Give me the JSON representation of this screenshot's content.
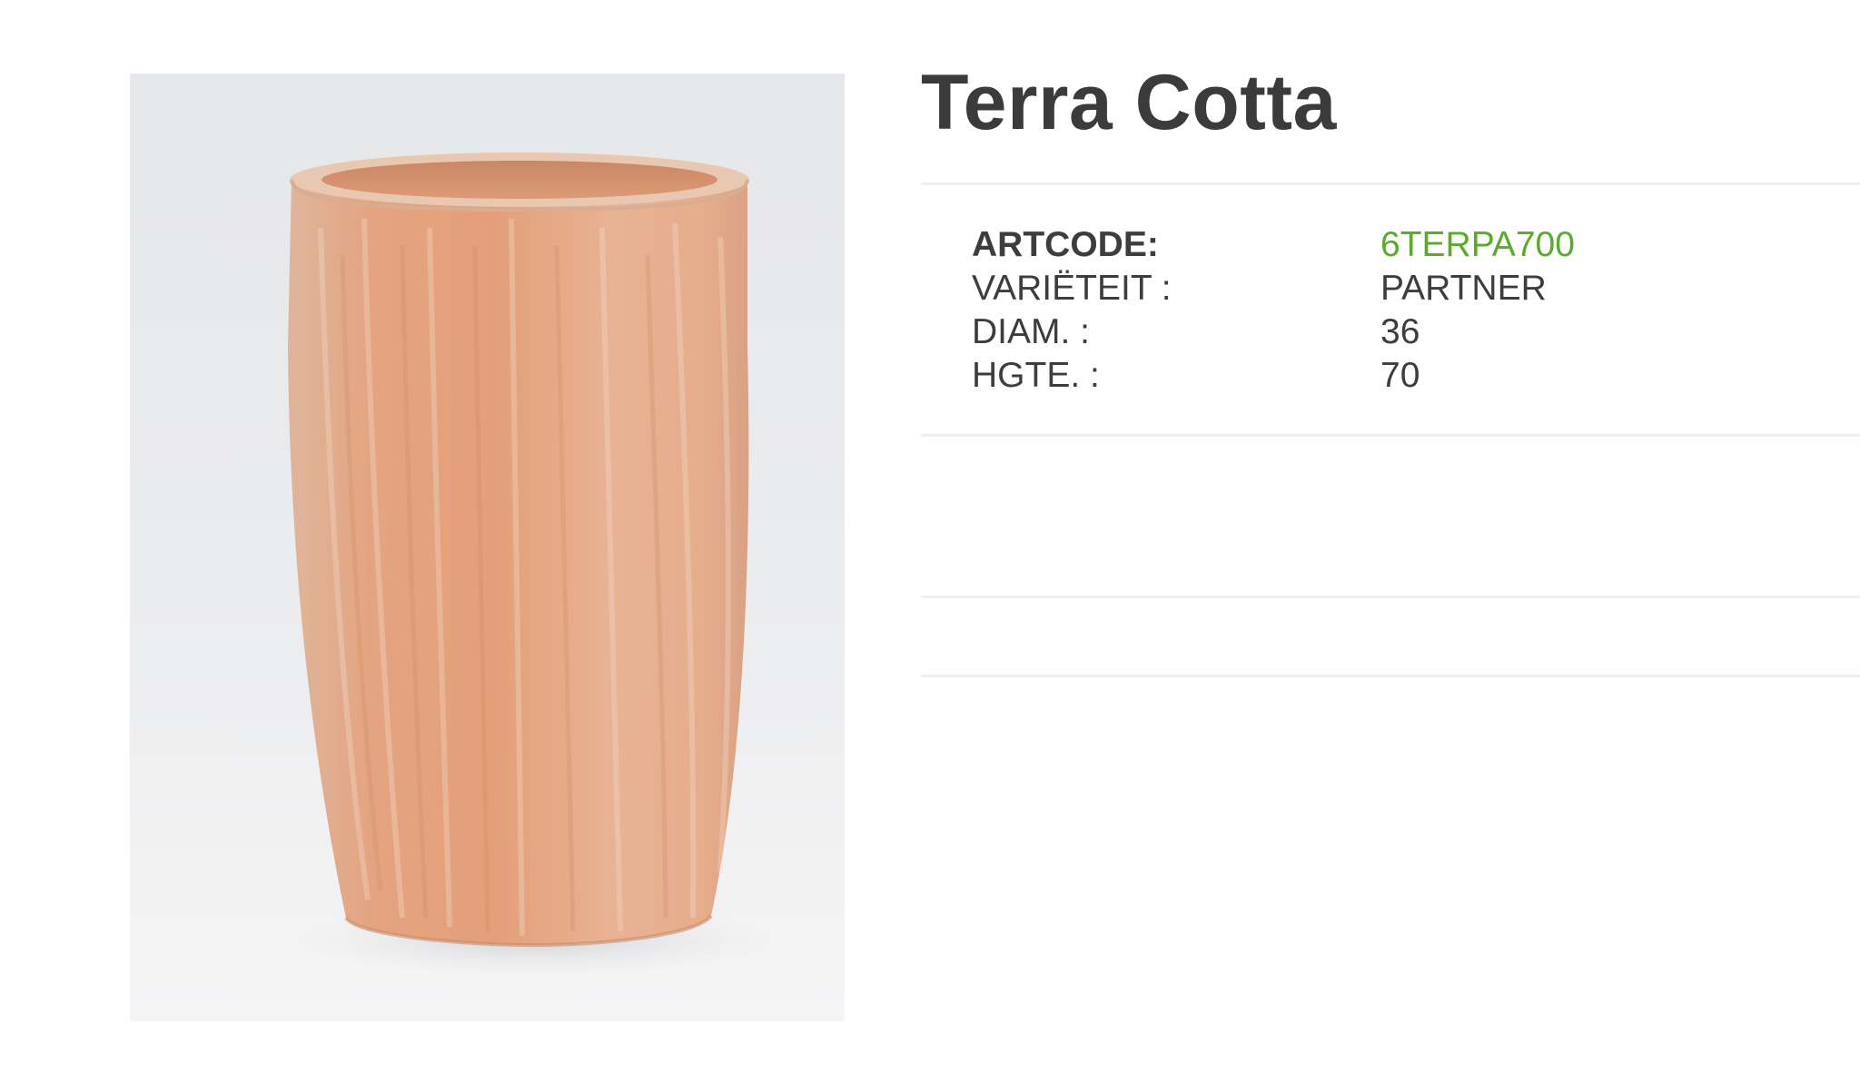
{
  "product": {
    "title": "Terra Cotta",
    "image_alt": "Terra Cotta pot"
  },
  "specs": [
    {
      "label": "ARTCODE:",
      "value": "6TERPA700",
      "emphasis": true
    },
    {
      "label": "VARIËTEIT :",
      "value": "PARTNER",
      "emphasis": false
    },
    {
      "label": "DIAM. :",
      "value": "36",
      "emphasis": false
    },
    {
      "label": "HGTE. :",
      "value": "70",
      "emphasis": false
    }
  ],
  "colors": {
    "title": "#3b3b3b",
    "text": "#3d3d3d",
    "accent": "#5aab2a",
    "divider": "#efefef",
    "pot": "#e1a07e"
  }
}
